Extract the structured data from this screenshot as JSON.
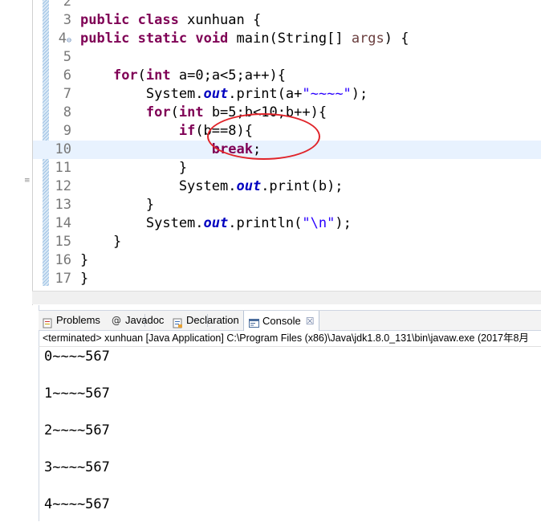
{
  "editor": {
    "lines": [
      {
        "num": "2",
        "segments": []
      },
      {
        "num": "3",
        "segments": [
          {
            "t": "kw",
            "v": "public"
          },
          {
            "t": "",
            "v": " "
          },
          {
            "t": "kw",
            "v": "class"
          },
          {
            "t": "",
            "v": " xunhuan {"
          }
        ]
      },
      {
        "num": "4",
        "fold": "⊖",
        "segments": [
          {
            "t": "kw",
            "v": "public"
          },
          {
            "t": "",
            "v": " "
          },
          {
            "t": "kw",
            "v": "static"
          },
          {
            "t": "",
            "v": " "
          },
          {
            "t": "kw",
            "v": "void"
          },
          {
            "t": "",
            "v": " main(String[] "
          },
          {
            "t": "prm",
            "v": "args"
          },
          {
            "t": "",
            "v": ") {"
          }
        ]
      },
      {
        "num": "5",
        "segments": []
      },
      {
        "num": "6",
        "segments": [
          {
            "t": "",
            "v": "    "
          },
          {
            "t": "kw",
            "v": "for"
          },
          {
            "t": "",
            "v": "("
          },
          {
            "t": "kw",
            "v": "int"
          },
          {
            "t": "",
            "v": " a=0;a<5;a++){"
          }
        ]
      },
      {
        "num": "7",
        "segments": [
          {
            "t": "",
            "v": "        System."
          },
          {
            "t": "fld",
            "v": "out"
          },
          {
            "t": "",
            "v": ".print(a+"
          },
          {
            "t": "str",
            "v": "\"~~~~\""
          },
          {
            "t": "",
            "v": ");"
          }
        ]
      },
      {
        "num": "8",
        "segments": [
          {
            "t": "",
            "v": "        "
          },
          {
            "t": "kw",
            "v": "for"
          },
          {
            "t": "",
            "v": "("
          },
          {
            "t": "kw",
            "v": "int"
          },
          {
            "t": "",
            "v": " b=5;b<10;b++){"
          }
        ]
      },
      {
        "num": "9",
        "segments": [
          {
            "t": "",
            "v": "            "
          },
          {
            "t": "kw",
            "v": "if"
          },
          {
            "t": "",
            "v": "(b==8){"
          }
        ]
      },
      {
        "num": "10",
        "current": true,
        "segments": [
          {
            "t": "",
            "v": "                "
          },
          {
            "t": "kw",
            "v": "break"
          },
          {
            "t": "",
            "v": ";"
          }
        ]
      },
      {
        "num": "11",
        "segments": [
          {
            "t": "",
            "v": "            }"
          }
        ]
      },
      {
        "num": "12",
        "segments": [
          {
            "t": "",
            "v": "            System."
          },
          {
            "t": "fld",
            "v": "out"
          },
          {
            "t": "",
            "v": ".print(b);"
          }
        ]
      },
      {
        "num": "13",
        "segments": [
          {
            "t": "",
            "v": "        }"
          }
        ]
      },
      {
        "num": "14",
        "segments": [
          {
            "t": "",
            "v": "        System."
          },
          {
            "t": "fld",
            "v": "out"
          },
          {
            "t": "",
            "v": ".println("
          },
          {
            "t": "str",
            "v": "\"\\n\""
          },
          {
            "t": "",
            "v": ");"
          }
        ]
      },
      {
        "num": "15",
        "segments": [
          {
            "t": "",
            "v": "    }"
          }
        ]
      },
      {
        "num": "16",
        "segments": [
          {
            "t": "",
            "v": "}"
          }
        ]
      },
      {
        "num": "17",
        "segments": [
          {
            "t": "",
            "v": "}"
          }
        ]
      }
    ]
  },
  "views": {
    "tabs": [
      {
        "label": "Problems",
        "icon": "problems-icon",
        "active": false
      },
      {
        "label": "Javadoc",
        "icon": "javadoc-icon",
        "active": false
      },
      {
        "label": "Declaration",
        "icon": "declaration-icon",
        "active": false
      },
      {
        "label": "Console",
        "icon": "console-icon",
        "active": true,
        "close": "☒"
      }
    ]
  },
  "console": {
    "header": "<terminated> xunhuan [Java Application] C:\\Program Files (x86)\\Java\\jdk1.8.0_131\\bin\\javaw.exe (2017年8月",
    "output": [
      "0~~~~567",
      "",
      "1~~~~567",
      "",
      "2~~~~567",
      "",
      "3~~~~567",
      "",
      "4~~~~567"
    ]
  },
  "colors": {
    "keyword": "#7f0055",
    "field": "#0000c0",
    "string": "#2a00ff",
    "param": "#6a3e3e",
    "annotation": "#e0242a",
    "current_line": "#e8f2fe"
  }
}
